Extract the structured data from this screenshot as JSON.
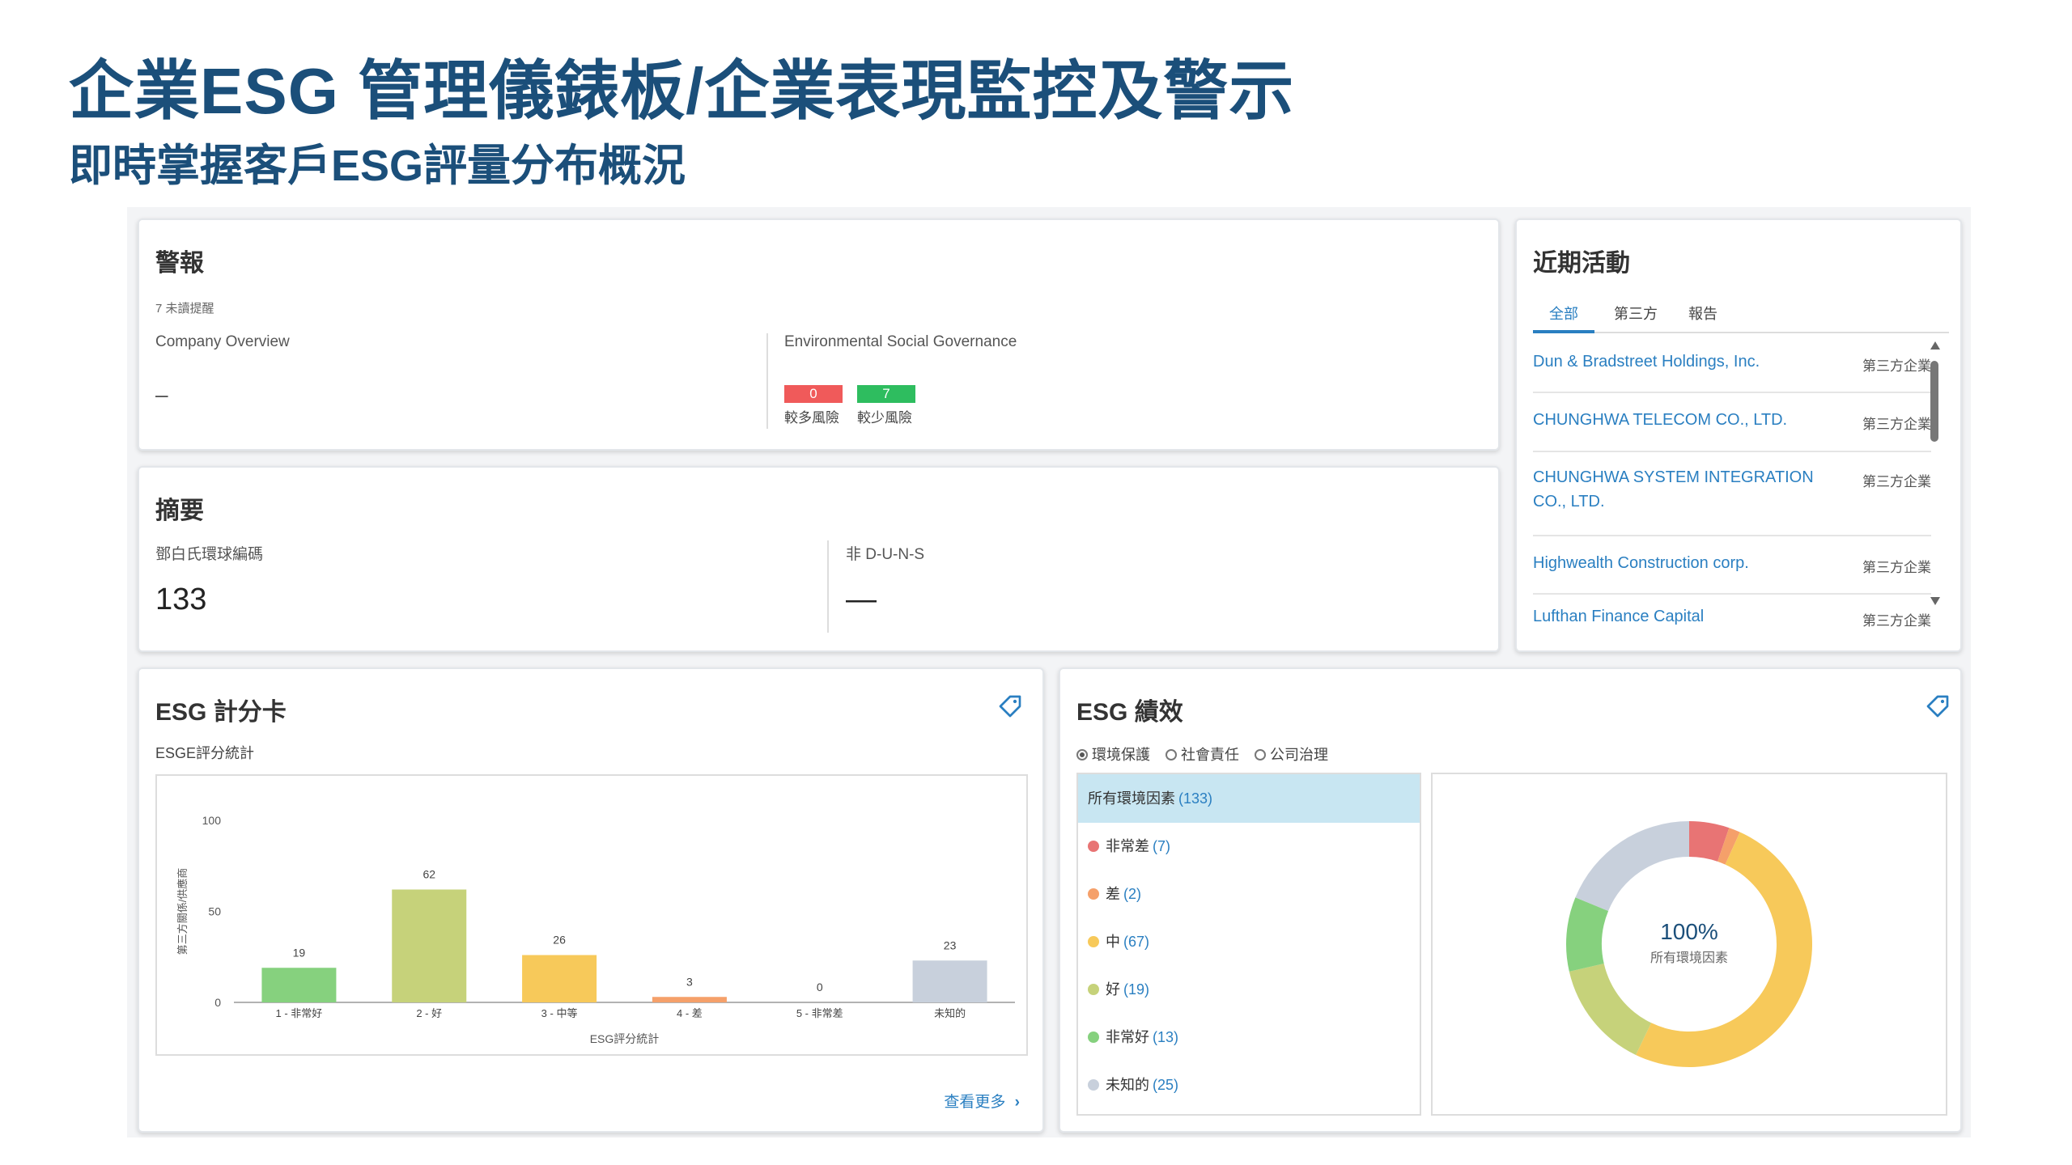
{
  "slide": {
    "title": "企業ESG 管理儀錶板/企業表現監控及警示",
    "subtitle": "即時掌握客戶ESG評量分布概況"
  },
  "alerts": {
    "title": "警報",
    "unread": "7 未讀提醒",
    "company_overview_label": "Company Overview",
    "company_overview_value": "–",
    "esg_label": "Environmental Social Governance",
    "high_risk_count": "0",
    "low_risk_count": "7",
    "high_risk_label": "較多風險",
    "low_risk_label": "較少風險",
    "colors": {
      "high": "#f05a5a",
      "low": "#2ebd5f"
    }
  },
  "summary": {
    "title": "摘要",
    "duns_label": "鄧白氏環球編碼",
    "duns_value": "133",
    "non_duns_label": "非 D-U-N-S",
    "non_duns_value": "—"
  },
  "recent": {
    "title": "近期活動",
    "tabs": [
      "全部",
      "第三方",
      "報告"
    ],
    "items": [
      {
        "name": "Dun & Bradstreet Holdings, Inc.",
        "type": "第三方企業"
      },
      {
        "name": "CHUNGHWA TELECOM CO., LTD.",
        "type": "第三方企業"
      },
      {
        "name": "CHUNGHWA SYSTEM INTEGRATION CO., LTD.",
        "type": "第三方企業"
      },
      {
        "name": "Highwealth Construction corp.",
        "type": "第三方企業"
      },
      {
        "name": "Lufthan Finance Capital",
        "type": "第三方企業"
      }
    ]
  },
  "scorecard": {
    "title": "ESG 計分卡",
    "subtitle": "ESGE評分統計",
    "see_more": "查看更多",
    "chart_data": {
      "type": "bar",
      "categories": [
        "1 - 非常好",
        "2 - 好",
        "3 - 中等",
        "4 - 差",
        "5 - 非常差",
        "未知的"
      ],
      "values": [
        19,
        62,
        26,
        3,
        0,
        23
      ],
      "colors": [
        "#86d17e",
        "#c6d27a",
        "#f7c95a",
        "#f5a06a",
        "#e88080",
        "#c8d0dc"
      ],
      "title": "",
      "xlabel": "ESG評分統計",
      "ylabel": "第三方關係/供應商",
      "ylim": [
        0,
        100
      ],
      "yticks": [
        0,
        50,
        100
      ]
    }
  },
  "performance": {
    "title": "ESG 績效",
    "radios": [
      {
        "label": "環境保護",
        "selected": true
      },
      {
        "label": "社會責任",
        "selected": false
      },
      {
        "label": "公司治理",
        "selected": false
      }
    ],
    "header": {
      "label": "所有環境因素",
      "count": "(133)"
    },
    "legend": [
      {
        "label": "非常差",
        "count": "(7)",
        "color": "#e87474"
      },
      {
        "label": "差",
        "count": "(2)",
        "color": "#f5a06a"
      },
      {
        "label": "中",
        "count": "(67)",
        "color": "#f7c95a"
      },
      {
        "label": "好",
        "count": "(19)",
        "color": "#c6d27a"
      },
      {
        "label": "非常好",
        "count": "(13)",
        "color": "#86d17e"
      },
      {
        "label": "未知的",
        "count": "(25)",
        "color": "#c8d0dc"
      }
    ],
    "chart_data": {
      "type": "pie",
      "categories": [
        "非常差",
        "差",
        "中",
        "好",
        "非常好",
        "未知的"
      ],
      "values": [
        7,
        2,
        67,
        19,
        13,
        25
      ],
      "colors": [
        "#e87474",
        "#f5a06a",
        "#f7c95a",
        "#c6d27a",
        "#86d17e",
        "#c8d0dc"
      ],
      "center_value": "100%",
      "center_label": "所有環境因素"
    }
  }
}
